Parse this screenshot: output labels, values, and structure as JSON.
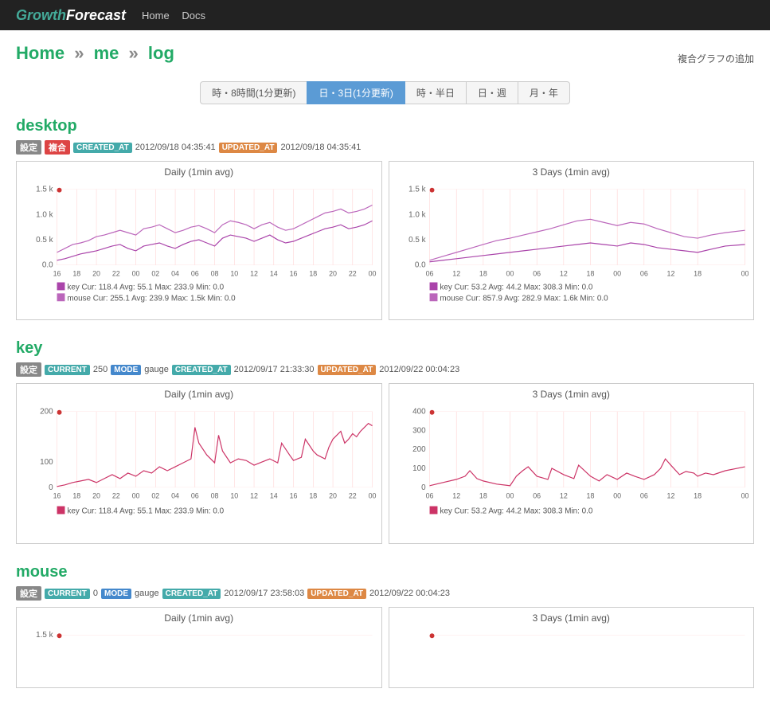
{
  "header": {
    "logo": "GrowthForecast",
    "nav": [
      "Home",
      "Docs"
    ]
  },
  "breadcrumb": {
    "home": "Home",
    "sep1": "»",
    "me": "me",
    "sep2": "»",
    "log": "log"
  },
  "add_graph_label": "複合グラフの追加",
  "tabs": [
    {
      "label": "時・8時間(1分更新)",
      "active": false
    },
    {
      "label": "日・3日(1分更新)",
      "active": true
    },
    {
      "label": "時・半日",
      "active": false
    },
    {
      "label": "日・週",
      "active": false
    },
    {
      "label": "月・年",
      "active": false
    }
  ],
  "sections": [
    {
      "id": "desktop",
      "title": "desktop",
      "badges": [
        {
          "type": "gray",
          "text": "設定"
        },
        {
          "type": "red",
          "text": "複合"
        },
        {
          "label": "CREATED_AT",
          "value": "2012/09/18 04:35:41"
        },
        {
          "label": "UPDATED_AT",
          "value": "2012/09/18 04:35:41"
        }
      ],
      "charts": [
        {
          "title": "Daily (1min avg)",
          "yLabels": [
            "1.5 k",
            "1.0 k",
            "0.5 k",
            "0.0"
          ],
          "xLabels": [
            "16",
            "18",
            "20",
            "22",
            "00",
            "02",
            "04",
            "06",
            "08",
            "10",
            "12",
            "14",
            "16",
            "18",
            "20",
            "22",
            "00"
          ],
          "legend": [
            {
              "color": "#aa44aa",
              "name": "key",
              "cur": "118.4",
              "avg": "55.1",
              "max": "233.9",
              "min": "0.0"
            },
            {
              "color": "#bb66bb",
              "name": "mouse",
              "cur": "255.1",
              "avg": "239.9",
              "max": "1.5k",
              "min": "0.0"
            }
          ]
        },
        {
          "title": "3 Days (1min avg)",
          "yLabels": [
            "1.5 k",
            "1.0 k",
            "0.5 k",
            "0.0"
          ],
          "xLabels": [
            "06",
            "12",
            "18",
            "00",
            "06",
            "12",
            "18",
            "00",
            "06",
            "12",
            "18",
            "00"
          ],
          "legend": [
            {
              "color": "#aa44aa",
              "name": "key",
              "cur": "53.2",
              "avg": "44.2",
              "max": "308.3",
              "min": "0.0"
            },
            {
              "color": "#bb66bb",
              "name": "mouse",
              "cur": "857.9",
              "avg": "282.9",
              "max": "1.6k",
              "min": "0.0"
            }
          ]
        }
      ]
    },
    {
      "id": "key",
      "title": "key",
      "badges": [
        {
          "type": "gray",
          "text": "設定"
        },
        {
          "label": "CURRENT",
          "value": "250"
        },
        {
          "label": "MODE",
          "value": "gauge"
        },
        {
          "label": "CREATED_AT",
          "value": "2012/09/17 21:33:30"
        },
        {
          "label": "UPDATED_AT",
          "value": "2012/09/22 00:04:23"
        }
      ],
      "charts": [
        {
          "title": "Daily (1min avg)",
          "yLabels": [
            "200",
            "100",
            "0"
          ],
          "xLabels": [
            "16",
            "18",
            "20",
            "22",
            "00",
            "02",
            "04",
            "06",
            "08",
            "10",
            "12",
            "14",
            "16",
            "18",
            "20",
            "22",
            "00"
          ],
          "legend": [
            {
              "color": "#cc3366",
              "name": "key",
              "cur": "118.4",
              "avg": "55.1",
              "max": "233.9",
              "min": "0.0"
            }
          ]
        },
        {
          "title": "3 Days (1min avg)",
          "yLabels": [
            "400",
            "300",
            "200",
            "100",
            "0"
          ],
          "xLabels": [
            "06",
            "12",
            "18",
            "00",
            "06",
            "12",
            "18",
            "00",
            "06",
            "12",
            "18",
            "00"
          ],
          "legend": [
            {
              "color": "#cc3366",
              "name": "key",
              "cur": "53.2",
              "avg": "44.2",
              "max": "308.3",
              "min": "0.0"
            }
          ]
        }
      ]
    },
    {
      "id": "mouse",
      "title": "mouse",
      "badges": [
        {
          "type": "gray",
          "text": "設定"
        },
        {
          "label": "CURRENT",
          "value": "0"
        },
        {
          "label": "MODE",
          "value": "gauge"
        },
        {
          "label": "CREATED_AT",
          "value": "2012/09/17 23:58:03"
        },
        {
          "label": "UPDATED_AT",
          "value": "2012/09/22 00:04:23"
        }
      ],
      "charts": [
        {
          "title": "Daily (1min avg)",
          "yLabels": [
            "1.5 k",
            ""
          ],
          "xLabels": [],
          "legend": []
        },
        {
          "title": "3 Days (1min avg)",
          "yLabels": [],
          "xLabels": [],
          "legend": []
        }
      ]
    }
  ]
}
